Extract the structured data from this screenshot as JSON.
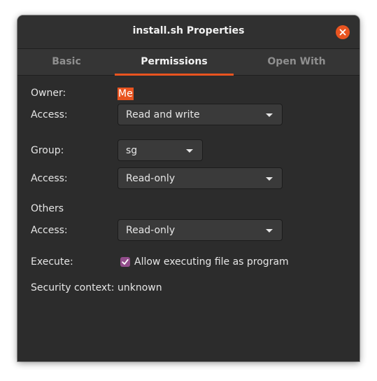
{
  "window": {
    "title": "install.sh Properties"
  },
  "tabs": [
    {
      "label": "Basic"
    },
    {
      "label": "Permissions"
    },
    {
      "label": "Open With"
    }
  ],
  "owner": {
    "label": "Owner:",
    "value": "Me",
    "access_label": "Access:",
    "access_value": "Read and write"
  },
  "group": {
    "label": "Group:",
    "value": "sg",
    "access_label": "Access:",
    "access_value": "Read-only"
  },
  "others": {
    "label": "Others",
    "access_label": "Access:",
    "access_value": "Read-only"
  },
  "execute": {
    "label": "Execute:",
    "checkbox_label": "Allow executing file as program",
    "checked": true
  },
  "security": {
    "label": "Security context:",
    "value": "unknown"
  },
  "colors": {
    "accent": "#e95420",
    "checkbox": "#924d8b",
    "window_bg": "#2c2c2c"
  },
  "icons": {
    "close": "close-icon",
    "dropdown": "chevron-down-icon",
    "check": "check-icon"
  }
}
